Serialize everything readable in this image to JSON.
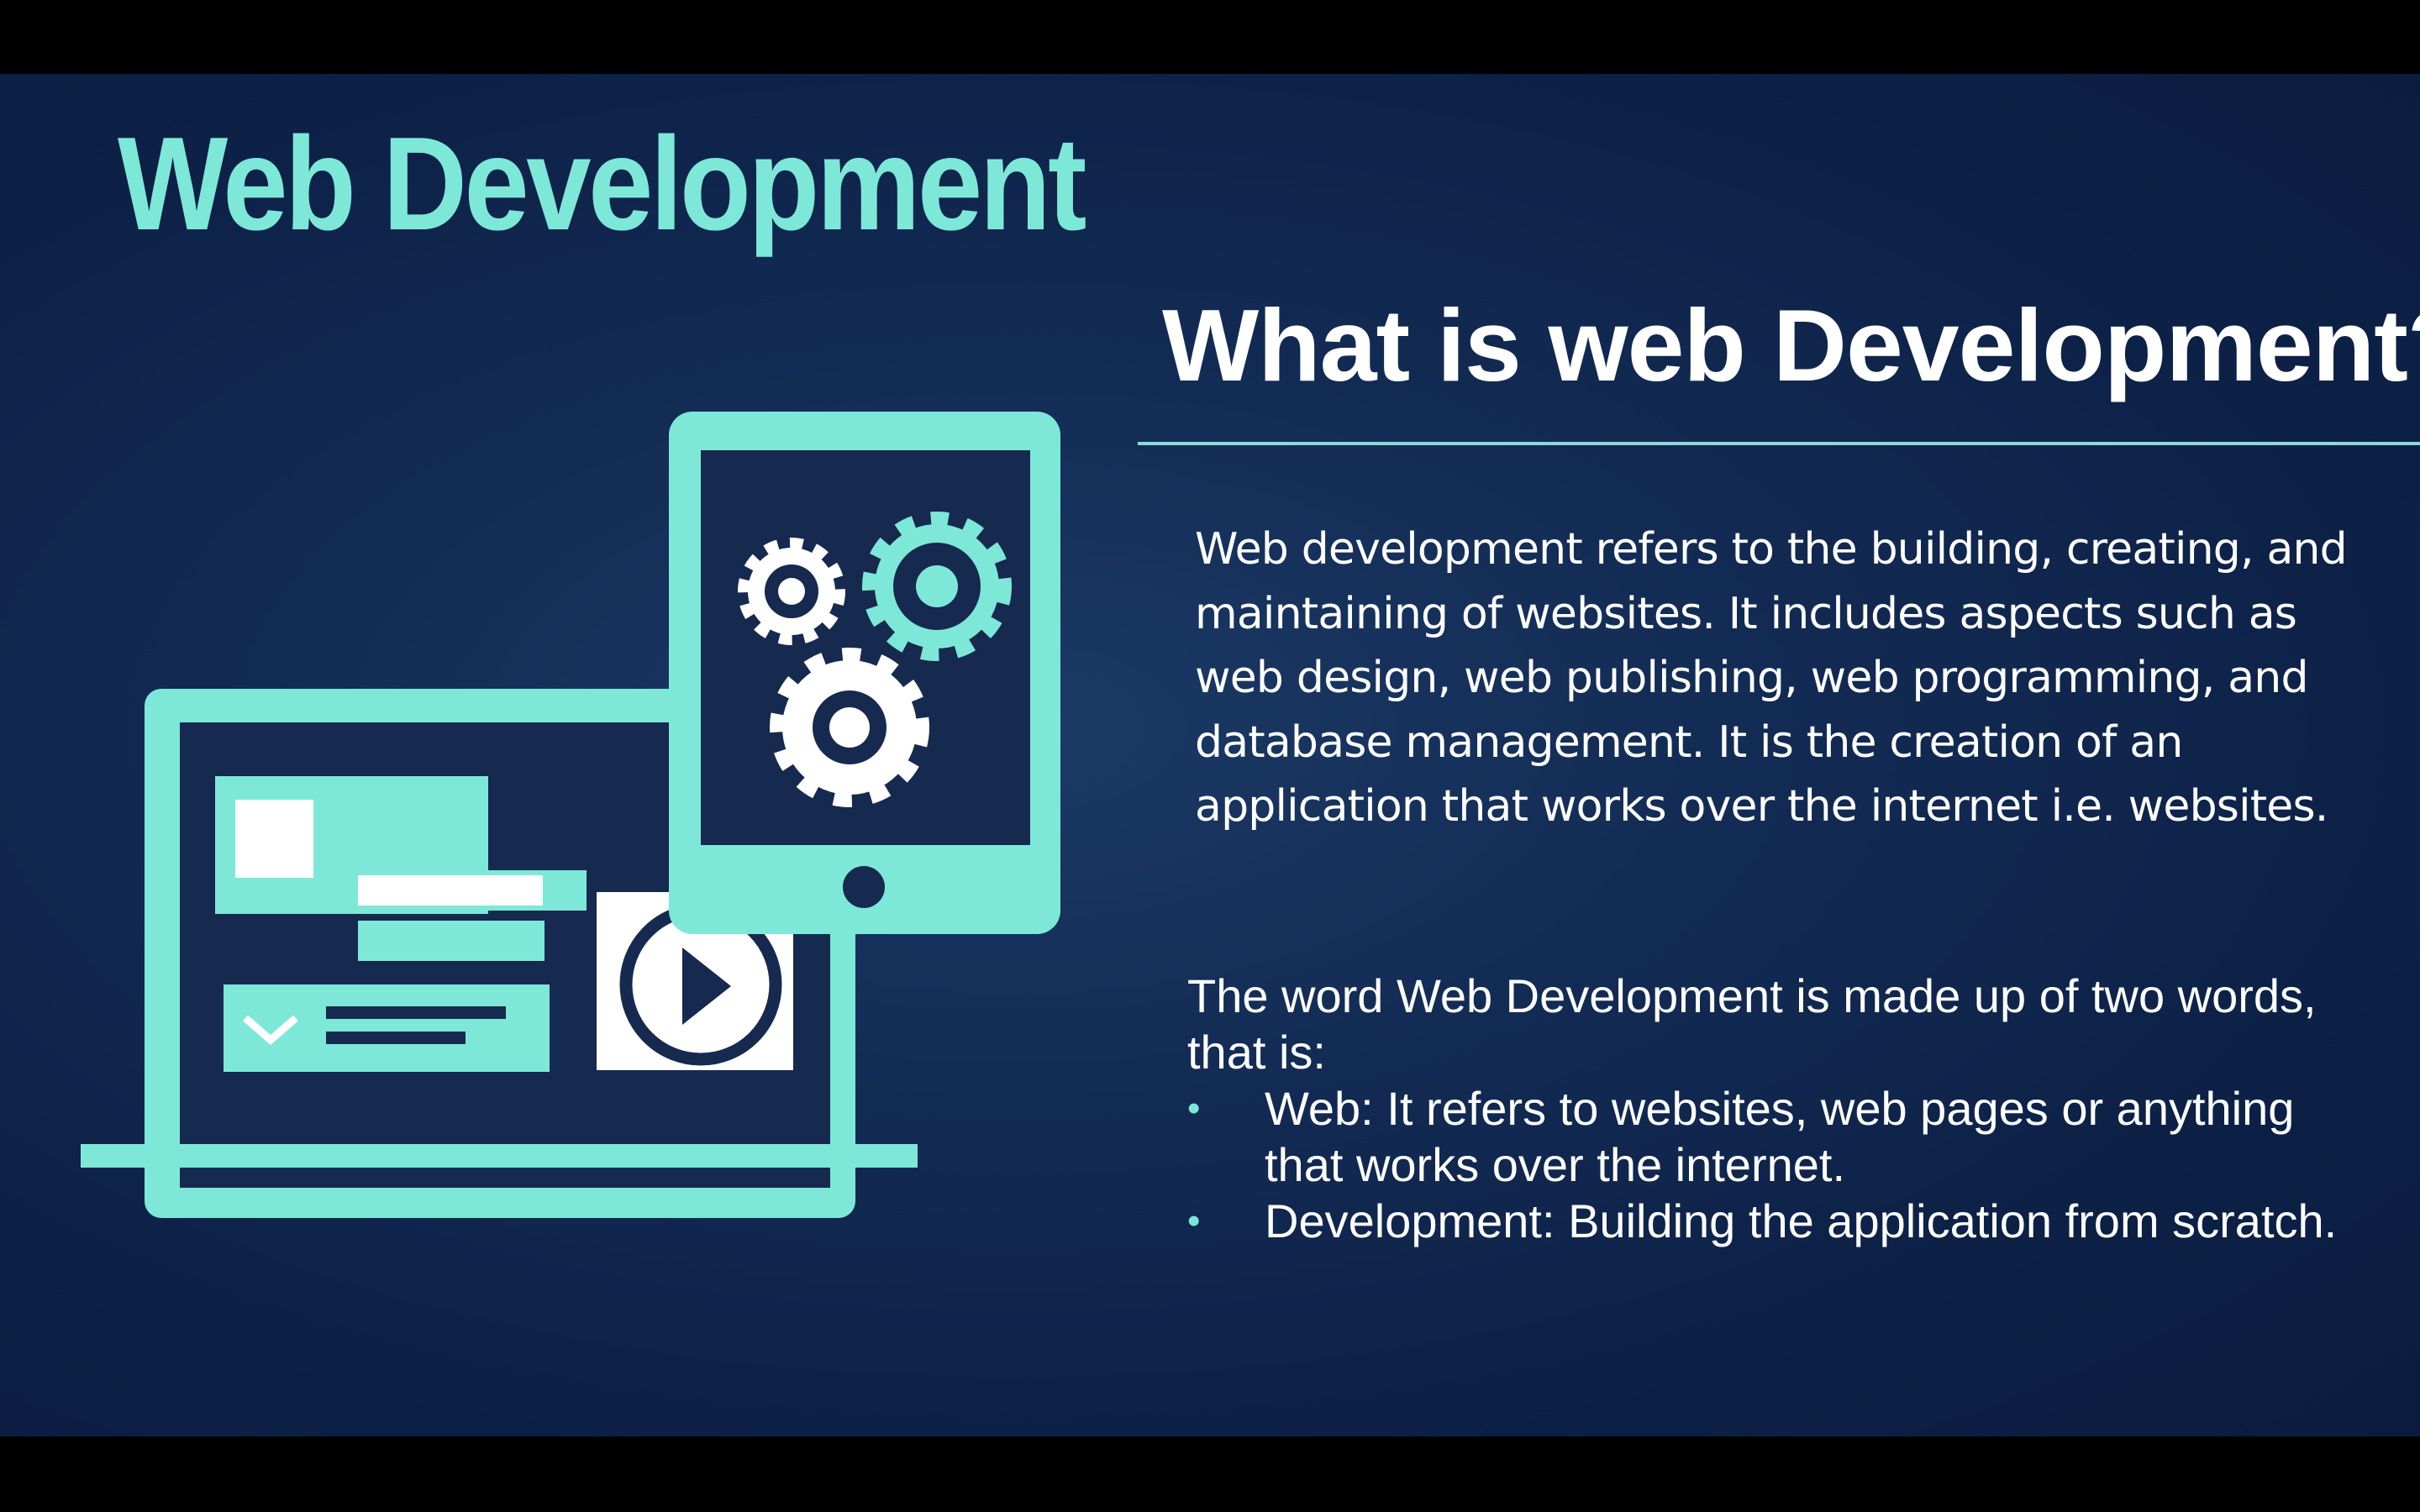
{
  "slide": {
    "title": "Web Development",
    "subtitle": "What is web Development?",
    "intro_paragraph": "Web development refers to the building, creating, and maintaining of websites. It includes aspects such as web design, web publishing, web programming, and database management. It is the creation of an application that works over the internet i.e. websites.",
    "explanation_lead": "The word Web Development is made up of two words, that is:",
    "bullets": [
      {
        "term": "Web:",
        "text": " It refers to websites, web pages or anything that works over the internet."
      },
      {
        "term": "Development:",
        "text": " Building the application from scratch."
      }
    ],
    "bullet_glyph": "•"
  },
  "illustration": {
    "icons": [
      "laptop-icon",
      "tablet-icon",
      "gear-icon",
      "play-icon",
      "image-icon",
      "chevron-down-icon"
    ]
  },
  "colors": {
    "accent": "#7ee8d8",
    "background": "#0f2550",
    "panel_dark": "#16294f",
    "text": "#ffffff"
  }
}
